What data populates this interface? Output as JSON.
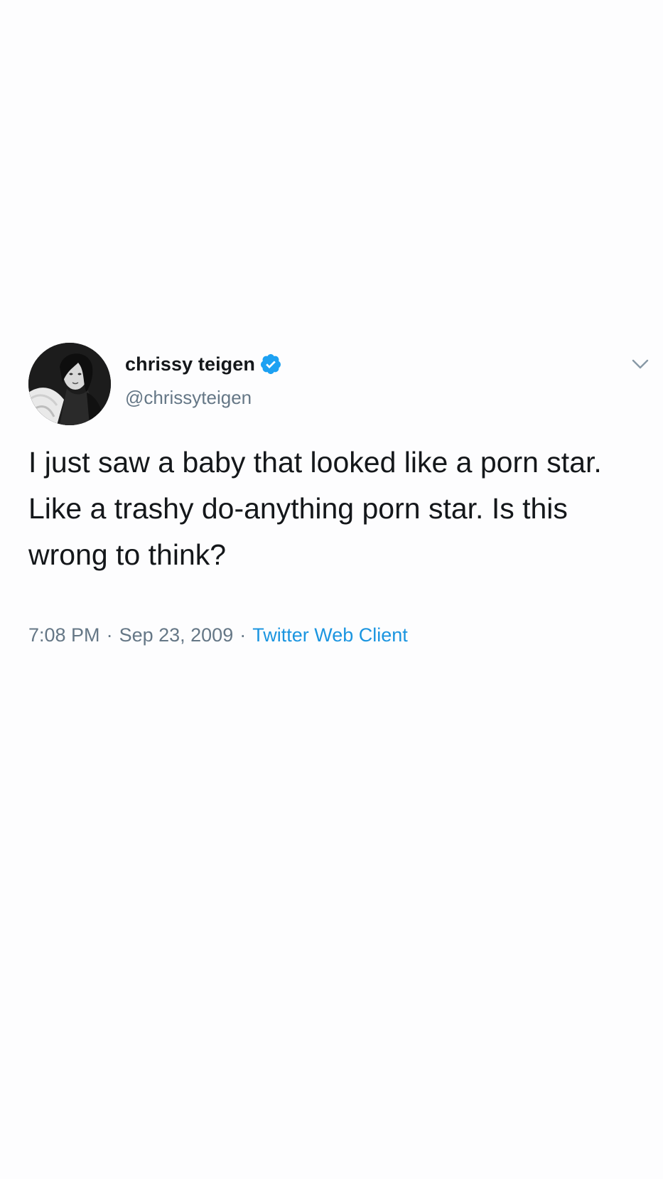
{
  "tweet": {
    "author": {
      "display_name": "chrissy teigen",
      "handle": "@chrissyteigen",
      "verified": true
    },
    "text": "I just saw a baby that looked like a porn star. Like a trashy do-anything porn star. Is this wrong to think?",
    "time": "7:08 PM",
    "separator": "·",
    "date": "Sep 23, 2009",
    "source": "Twitter Web Client",
    "icons": {
      "verified": "verified-badge-icon",
      "menu": "chevron-down-icon"
    },
    "colors": {
      "text": "#14171a",
      "secondary": "#657786",
      "link": "#1b95e0",
      "verified": "#1da1f2"
    }
  }
}
